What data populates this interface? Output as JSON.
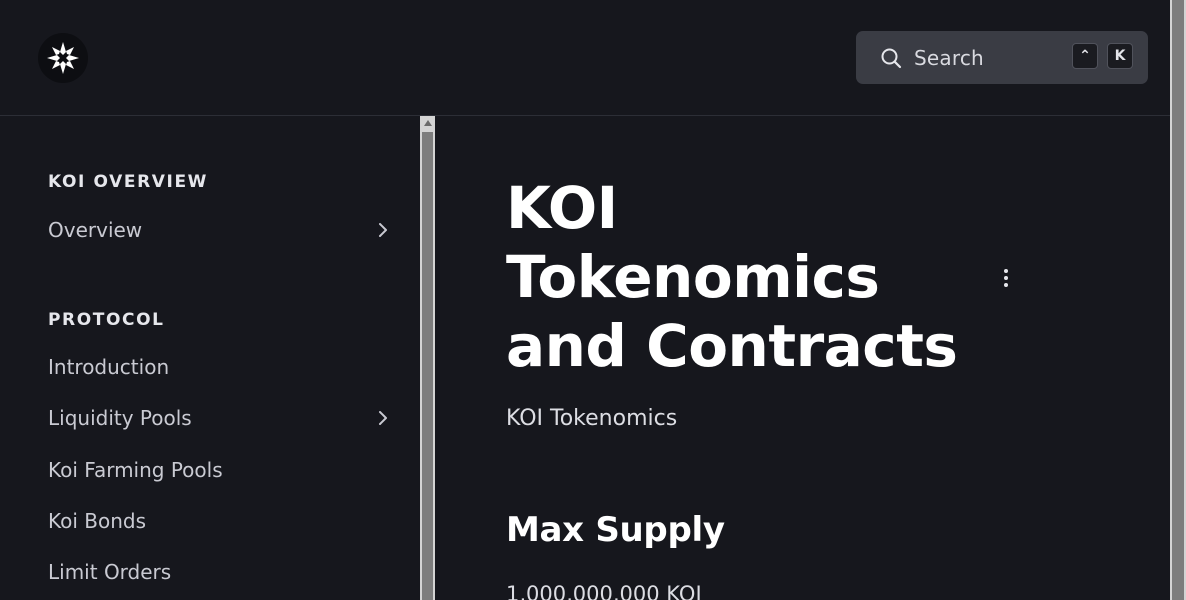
{
  "header": {
    "logo": "koi-logo-icon",
    "search": {
      "placeholder": "Search",
      "shortcut_modifier": "⌃",
      "shortcut_key": "K"
    }
  },
  "sidebar": {
    "sections": [
      {
        "title": "KOI OVERVIEW",
        "items": [
          {
            "label": "Overview",
            "expandable": true
          }
        ]
      },
      {
        "title": "PROTOCOL",
        "items": [
          {
            "label": "Introduction",
            "expandable": false
          },
          {
            "label": "Liquidity Pools",
            "expandable": true
          },
          {
            "label": "Koi Farming Pools",
            "expandable": false
          },
          {
            "label": "Koi Bonds",
            "expandable": false
          },
          {
            "label": "Limit Orders",
            "expandable": false
          }
        ]
      }
    ]
  },
  "main": {
    "title": "KOI Tokenomics and Contracts",
    "subtitle": "KOI Tokenomics",
    "section_heading": "Max Supply",
    "max_supply": "1,000,000,000 KOI"
  },
  "colors": {
    "background": "#16171d",
    "search_bg": "#3a3c44",
    "text_primary": "#ffffff",
    "text_secondary": "#c9cad2"
  }
}
